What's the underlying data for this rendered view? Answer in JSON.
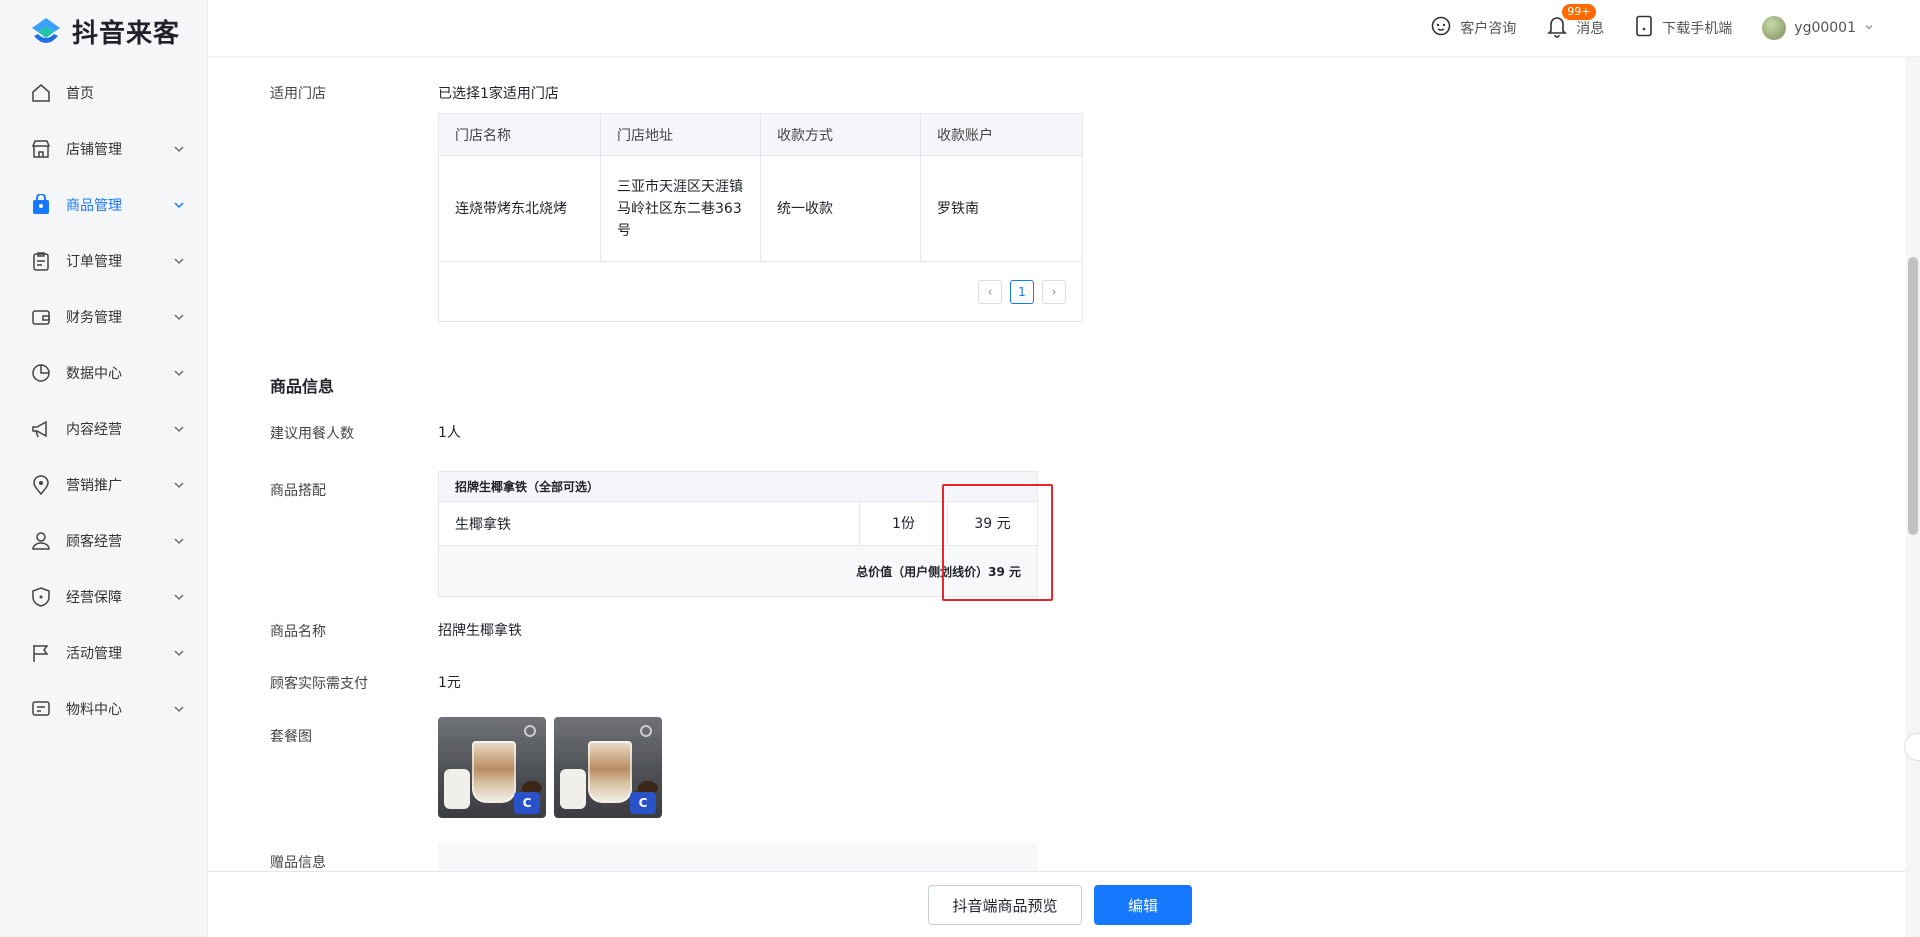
{
  "app": {
    "logo_text": "抖音来客"
  },
  "topbar": {
    "consult": "客户咨询",
    "messages": "消息",
    "messages_badge": "99+",
    "download": "下载手机端",
    "username": "yg00001"
  },
  "sidebar": {
    "items": [
      {
        "label": "首页",
        "icon": "home-icon",
        "has_children": false
      },
      {
        "label": "店铺管理",
        "icon": "store-icon",
        "has_children": true
      },
      {
        "label": "商品管理",
        "icon": "goods-bag-icon",
        "has_children": true,
        "active": true
      },
      {
        "label": "订单管理",
        "icon": "clipboard-icon",
        "has_children": true
      },
      {
        "label": "财务管理",
        "icon": "wallet-icon",
        "has_children": true
      },
      {
        "label": "数据中心",
        "icon": "pie-chart-icon",
        "has_children": true
      },
      {
        "label": "内容经营",
        "icon": "megaphone-icon",
        "has_children": true
      },
      {
        "label": "营销推广",
        "icon": "location-pin-icon",
        "has_children": true
      },
      {
        "label": "顾客经营",
        "icon": "user-icon",
        "has_children": true
      },
      {
        "label": "经营保障",
        "icon": "shield-icon",
        "has_children": true
      },
      {
        "label": "活动管理",
        "icon": "flag-icon",
        "has_children": true
      },
      {
        "label": "物料中心",
        "icon": "material-icon",
        "has_children": true
      }
    ]
  },
  "stores": {
    "label": "适用门店",
    "summary": "已选择1家适用门店",
    "columns": [
      "门店名称",
      "门店地址",
      "收款方式",
      "收款账户"
    ],
    "rows": [
      [
        "连烧带烤东北烧烤",
        "三亚市天涯区天涯镇马岭社区东二巷363号",
        "统一收款",
        "罗铁南"
      ]
    ],
    "pagination": {
      "current": "1",
      "prev": "‹",
      "next": "›"
    }
  },
  "product": {
    "section_title": "商品信息",
    "diners_label": "建议用餐人数",
    "diners_value": "1人",
    "combo_label": "商品搭配",
    "combo_group": "招牌生椰拿铁（全部可选）",
    "combo_items": [
      {
        "name": "生椰拿铁",
        "qty": "1份",
        "price": "39 元"
      }
    ],
    "combo_total": "总价值（用户侧划线价）39 元",
    "name_label": "商品名称",
    "name_value": "招牌生椰拿铁",
    "pay_label": "顾客实际需支付",
    "pay_value": "1元",
    "images_label": "套餐图",
    "image_tag": "C",
    "gift_label": "赠品信息"
  },
  "actions": {
    "preview": "抖音端商品预览",
    "edit": "编辑"
  },
  "colors": {
    "accent": "#1677ff",
    "highlight_box": "#e8262d",
    "badge": "#ff6a00"
  }
}
